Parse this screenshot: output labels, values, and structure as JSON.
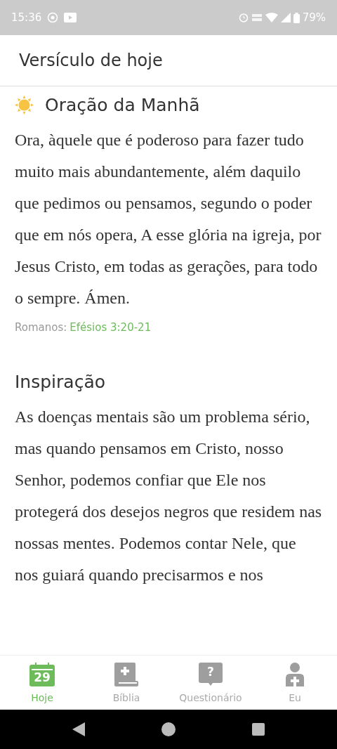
{
  "status_bar": {
    "time": "15:36",
    "battery": "79%"
  },
  "header": {
    "title": "Versículo de hoje"
  },
  "prayer": {
    "title": "Oração da Manhã",
    "text": "Ora, àquele que é poderoso para fazer tudo muito mais abundantemente, além daquilo que pedimos ou pensamos, segundo o poder que em nós opera, A esse glória na igreja, por Jesus Cristo, em todas as gerações, para todo o sempre. Ámen.",
    "source_label": "Romanos:",
    "reference": "Efésios 3:20-21"
  },
  "inspiration": {
    "title": "Inspiração",
    "text": "As doenças mentais são um problema sério, mas quando pensamos em Cristo, nosso Senhor, podemos confiar que Ele nos protegerá dos desejos negros que residem nas nossas mentes. Podemos contar Nele, que nos guiará quando precisarmos e nos"
  },
  "bottom_nav": [
    {
      "kind": "calendar",
      "label": "Hoje",
      "badge": "29",
      "selected": true
    },
    {
      "kind": "bible",
      "label": "Bíblia",
      "selected": false
    },
    {
      "kind": "quiz",
      "label": "Questionário",
      "badge": "?",
      "selected": false
    },
    {
      "kind": "profile",
      "label": "Eu",
      "selected": false
    }
  ]
}
